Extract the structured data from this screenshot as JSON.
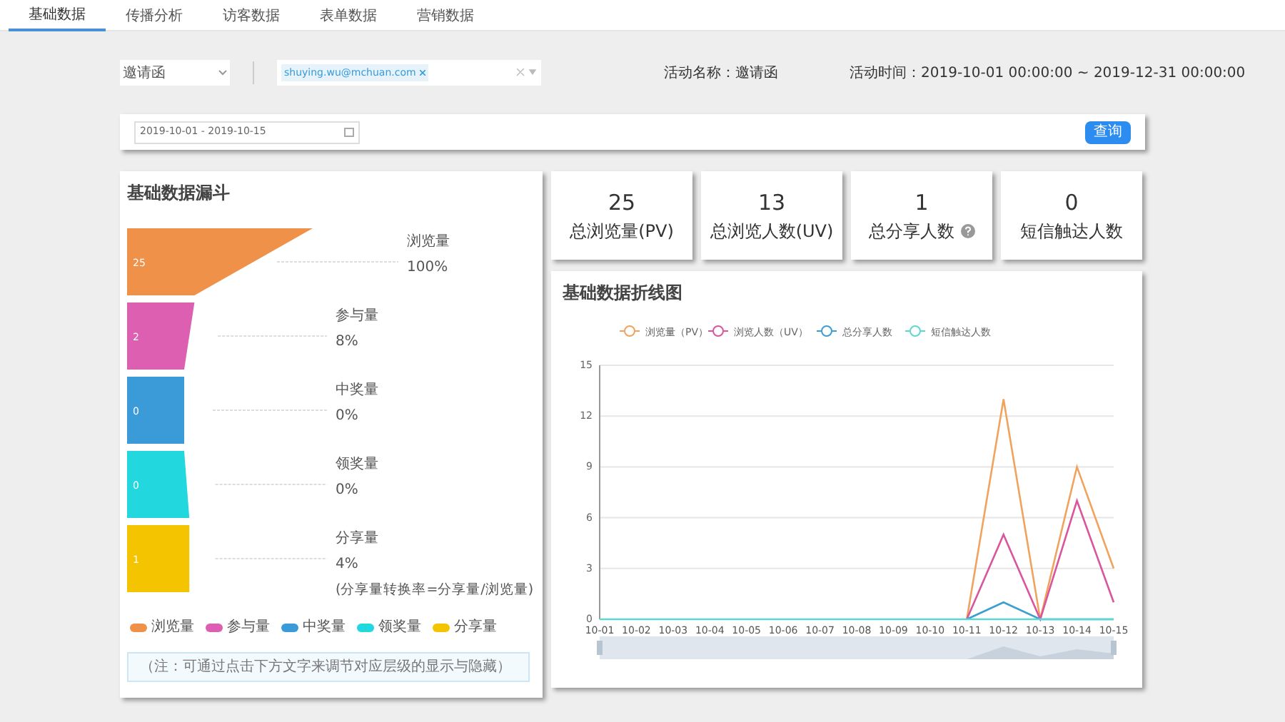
{
  "tabs": [
    {
      "label": "基础数据",
      "selected": true
    },
    {
      "label": "传播分析",
      "selected": false
    },
    {
      "label": "访客数据",
      "selected": false
    },
    {
      "label": "表单数据",
      "selected": false
    },
    {
      "label": "营销数据",
      "selected": false
    }
  ],
  "filters": {
    "activity_select": "邀请函",
    "user_tags": [
      "shuying.wu@mchuan.com"
    ],
    "activity_name": "活动名称：邀请函",
    "activity_time": "活动时间：2019-10-01 00:00:00 ~ 2019-12-31 00:00:00"
  },
  "query": {
    "date_range": "2019-10-01 - 2019-10-15",
    "button": "查询"
  },
  "funnel": {
    "title": "基础数据漏斗",
    "stages": [
      {
        "name": "浏览量",
        "value": "25",
        "percent": "100%",
        "color": "#f0914a"
      },
      {
        "name": "参与量",
        "value": "2",
        "percent": "8%",
        "color": "#dc5fb1"
      },
      {
        "name": "中奖量",
        "value": "0",
        "percent": "0%",
        "color": "#3a9bd8"
      },
      {
        "name": "领奖量",
        "value": "0",
        "percent": "0%",
        "color": "#22d8de"
      },
      {
        "name": "分享量",
        "value": "1",
        "percent": "4%",
        "color": "#f5c400",
        "note": "(分享量转换率=分享量/浏览量)"
      }
    ],
    "legend": [
      {
        "name": "浏览量",
        "color": "#f0914a"
      },
      {
        "name": "参与量",
        "color": "#dc5fb1"
      },
      {
        "name": "中奖量",
        "color": "#3a9bd8"
      },
      {
        "name": "领奖量",
        "color": "#22d8de"
      },
      {
        "name": "分享量",
        "color": "#f5c400"
      }
    ],
    "hint": "（注：可通过点击下方文字来调节对应层级的显示与隐藏）"
  },
  "stats": [
    {
      "value": "25",
      "label": "总浏览量(PV)",
      "info_icon": false
    },
    {
      "value": "13",
      "label": "总浏览人数(UV)",
      "info_icon": false
    },
    {
      "value": "1",
      "label": "总分享人数",
      "info_icon": true
    },
    {
      "value": "0",
      "label": "短信触达人数",
      "info_icon": false
    }
  ],
  "line_chart": {
    "title": "基础数据折线图",
    "chart_data": {
      "type": "line",
      "categories": [
        "10-01",
        "10-02",
        "10-03",
        "10-04",
        "10-05",
        "10-06",
        "10-07",
        "10-08",
        "10-09",
        "10-10",
        "10-11",
        "10-12",
        "10-13",
        "10-14",
        "10-15"
      ],
      "ylim": [
        0,
        15
      ],
      "yticks": [
        0,
        3,
        6,
        9,
        12,
        15
      ],
      "grid": true,
      "legend": "top",
      "series": [
        {
          "name": "浏览量（PV）",
          "color": "#f0a35d",
          "values": [
            null,
            null,
            null,
            null,
            null,
            null,
            null,
            null,
            null,
            null,
            0,
            13,
            0,
            9,
            3
          ]
        },
        {
          "name": "浏览人数（UV）",
          "color": "#d9559c",
          "values": [
            null,
            null,
            null,
            null,
            null,
            null,
            null,
            null,
            null,
            null,
            0,
            5,
            0,
            7,
            1
          ]
        },
        {
          "name": "总分享人数",
          "color": "#3b9fd0",
          "values": [
            null,
            null,
            null,
            null,
            null,
            null,
            null,
            null,
            null,
            null,
            0,
            1,
            0,
            0,
            0
          ]
        },
        {
          "name": "短信触达人数",
          "color": "#5fd6d0",
          "values": [
            0,
            0,
            0,
            0,
            0,
            0,
            0,
            0,
            0,
            0,
            0,
            0,
            0,
            0,
            0
          ]
        }
      ]
    }
  }
}
